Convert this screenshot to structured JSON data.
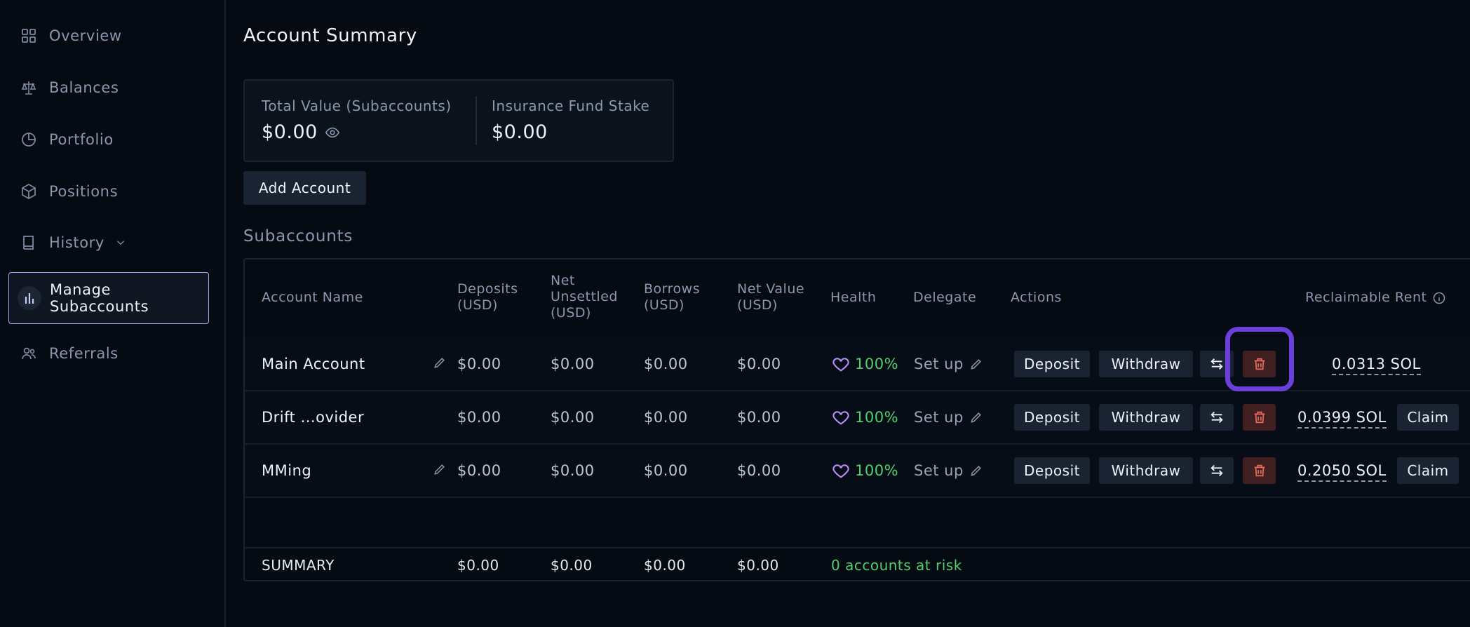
{
  "sidebar": {
    "items": [
      {
        "label": "Overview",
        "icon": "grid-icon"
      },
      {
        "label": "Balances",
        "icon": "scale-icon"
      },
      {
        "label": "Portfolio",
        "icon": "pie-chart-icon"
      },
      {
        "label": "Positions",
        "icon": "cube-icon"
      },
      {
        "label": "History",
        "icon": "book-icon"
      },
      {
        "label_line1": "Manage",
        "label_line2": "Subaccounts",
        "icon": "bar-chart-icon",
        "active": true
      },
      {
        "label": "Referrals",
        "icon": "users-icon"
      }
    ]
  },
  "page_title": "Account Summary",
  "summary": {
    "total_label": "Total Value (Subaccounts)",
    "total_value": "$0.00",
    "insurance_label": "Insurance Fund Stake",
    "insurance_value": "$0.00"
  },
  "add_account_label": "Add Account",
  "subaccounts_title": "Subaccounts",
  "table": {
    "headers": {
      "name": "Account Name",
      "deposits_l1": "Deposits",
      "deposits_l2": "(USD)",
      "unsettled_l1": "Net",
      "unsettled_l2": "Unsettled",
      "unsettled_l3": "(USD)",
      "borrows_l1": "Borrows",
      "borrows_l2": "(USD)",
      "netvalue_l1": "Net Value",
      "netvalue_l2": "(USD)",
      "health": "Health",
      "delegate": "Delegate",
      "actions": "Actions",
      "rent": "Reclaimable Rent"
    },
    "rows": [
      {
        "name": "Main Account",
        "deposits": "$0.00",
        "unsettled": "$0.00",
        "borrows": "$0.00",
        "net_value": "$0.00",
        "health": "100%",
        "delegate": "Set up",
        "deposit_label": "Deposit",
        "withdraw_label": "Withdraw",
        "rent": "0.0313 SOL"
      },
      {
        "name": "Drift ...ovider",
        "deposits": "$0.00",
        "unsettled": "$0.00",
        "borrows": "$0.00",
        "net_value": "$0.00",
        "health": "100%",
        "delegate": "Set up",
        "deposit_label": "Deposit",
        "withdraw_label": "Withdraw",
        "rent": "0.0399 SOL",
        "claim_label": "Claim"
      },
      {
        "name": "MMing",
        "deposits": "$0.00",
        "unsettled": "$0.00",
        "borrows": "$0.00",
        "net_value": "$0.00",
        "health": "100%",
        "delegate": "Set up",
        "deposit_label": "Deposit",
        "withdraw_label": "Withdraw",
        "rent": "0.2050 SOL",
        "claim_label": "Claim"
      }
    ],
    "summary_row": {
      "label": "SUMMARY",
      "deposits": "$0.00",
      "unsettled": "$0.00",
      "borrows": "$0.00",
      "net_value": "$0.00",
      "risk": "0 accounts at risk"
    }
  },
  "colors": {
    "background": "#050a13",
    "accent_green": "#4fcf6e",
    "highlight_purple": "#6a3fdb",
    "trash_red": "#e2685a",
    "heart_purple": "#b88cf5"
  }
}
